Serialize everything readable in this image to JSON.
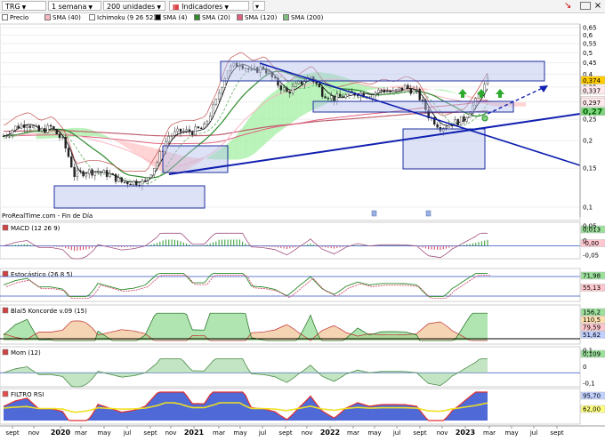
{
  "toolbar": {
    "symbol": "TRG",
    "period": "1 semana",
    "units": "200 unidades",
    "indicators_label": "Indicadores"
  },
  "legend": [
    {
      "label": "Precio",
      "color": "#ffffff"
    },
    {
      "label": "SMA (40)",
      "color": "#f7b6c2"
    },
    {
      "label": "Ichimoku (9 26 52)",
      "color": "#ffffff"
    },
    {
      "label": "SMA (4)",
      "color": "#000000"
    },
    {
      "label": "SMA (20)",
      "color": "#2e8b2e"
    },
    {
      "label": "SMA (120)",
      "color": "#e06080"
    },
    {
      "label": "SMA (200)",
      "color": "#7fbf7f"
    }
  ],
  "source_label": "ProRealTime.com - Fin de Día",
  "panels": {
    "macd": {
      "label": "MACD (12 26 9)",
      "ticks": [
        "0,05",
        "0",
        "-0,05"
      ],
      "values": [
        "0,013",
        "-0,00"
      ]
    },
    "stoch": {
      "label": "Estocástico (26 8 5)",
      "values": [
        "71,98",
        "55,13"
      ]
    },
    "koncorde": {
      "label": "Blai5 Koncorde v.09 (15)",
      "values": [
        "156,2",
        "110,5",
        "79,59",
        "51,62"
      ]
    },
    "mom": {
      "label": "Mom (12)",
      "values": [
        "0,109"
      ],
      "ticks": [
        "0,1",
        "0",
        "-0,1"
      ]
    },
    "rsi": {
      "label": "FILTRO RSI",
      "values": [
        "95,70",
        "62,00"
      ]
    }
  },
  "chart_data": {
    "type": "candlestick",
    "title": "TRG",
    "x_axis_labels": [
      "sept",
      "nov",
      "2020",
      "mar",
      "may",
      "jul",
      "sept",
      "nov",
      "2021",
      "mar",
      "may",
      "jul",
      "sept",
      "nov",
      "2022",
      "mar",
      "may",
      "jul",
      "sept",
      "nov",
      "2023",
      "mar",
      "may",
      "jul",
      "sept"
    ],
    "y_axis": {
      "scale": "log",
      "ticks": [
        "0,65",
        "0,6",
        "0,55",
        "0,5",
        "0,45",
        "0,4",
        "0,35",
        "0,3",
        "0,25",
        "0,2",
        "0,15",
        "0,1"
      ],
      "range": [
        0.09,
        0.67
      ]
    },
    "last_price": "0,374",
    "price_labels": [
      "0,374",
      "0,337",
      "0,303",
      "0,297",
      "0,27"
    ],
    "price_series": {
      "dates": [
        "2019-09",
        "2019-10",
        "2019-11",
        "2019-12",
        "2020-01",
        "2020-02",
        "2020-03",
        "2020-04",
        "2020-05",
        "2020-06",
        "2020-07",
        "2020-08",
        "2020-09",
        "2020-10",
        "2020-11",
        "2020-12",
        "2021-01",
        "2021-02",
        "2021-03",
        "2021-04",
        "2021-05",
        "2021-06",
        "2021-07",
        "2021-08",
        "2021-09",
        "2021-10",
        "2021-11",
        "2021-12",
        "2022-01",
        "2022-02",
        "2022-03",
        "2022-04",
        "2022-05",
        "2022-06",
        "2022-07",
        "2022-08",
        "2022-09",
        "2022-10",
        "2022-11",
        "2022-12",
        "2023-01",
        "2023-02"
      ],
      "close": [
        0.21,
        0.23,
        0.24,
        0.22,
        0.23,
        0.2,
        0.14,
        0.145,
        0.145,
        0.14,
        0.13,
        0.13,
        0.13,
        0.16,
        0.21,
        0.22,
        0.22,
        0.23,
        0.3,
        0.42,
        0.45,
        0.41,
        0.43,
        0.37,
        0.33,
        0.36,
        0.39,
        0.33,
        0.31,
        0.32,
        0.33,
        0.32,
        0.34,
        0.33,
        0.35,
        0.33,
        0.26,
        0.23,
        0.24,
        0.25,
        0.3,
        0.37
      ]
    },
    "annotations": [
      "ProRealTime.com - Fin de Día"
    ]
  }
}
